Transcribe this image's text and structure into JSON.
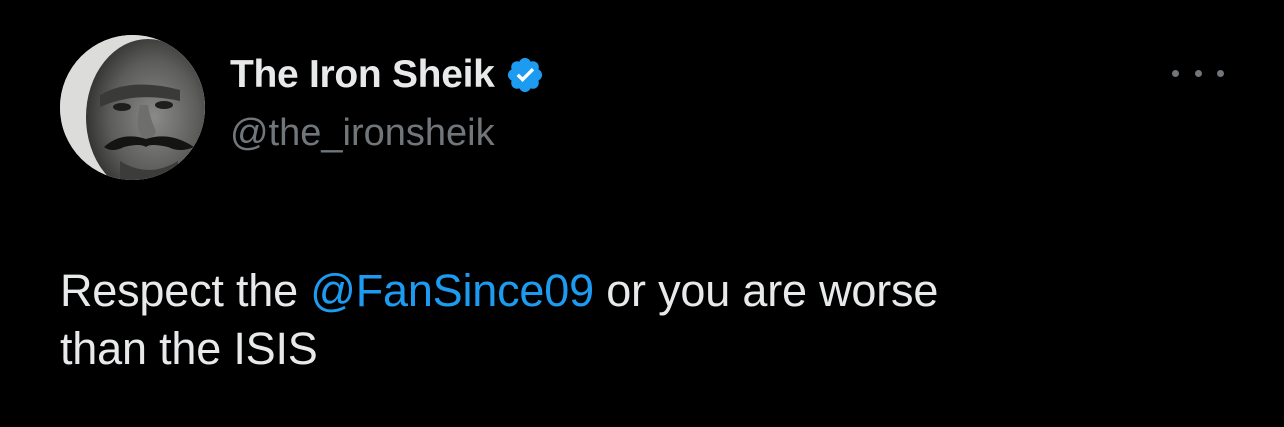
{
  "tweet": {
    "author": {
      "display_name": "The Iron Sheik",
      "handle": "@the_ironsheik",
      "verified": true,
      "verified_icon": "verified-badge-icon",
      "avatar_icon": "avatar-photo"
    },
    "more_icon": "more-options-icon",
    "text": {
      "before": "Respect the ",
      "mention": "@FanSince09",
      "after_line1": " or you are worse",
      "line2": "than the ISIS"
    }
  },
  "colors": {
    "background": "#000000",
    "primary_text": "#e7e9ea",
    "secondary_text": "#71767b",
    "accent": "#1d9bf0"
  }
}
